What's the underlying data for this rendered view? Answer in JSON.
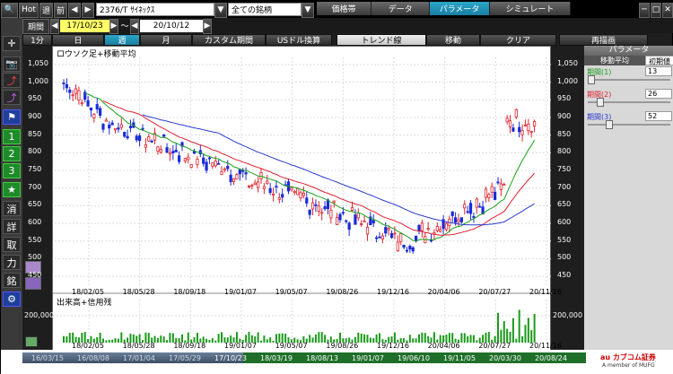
{
  "toolbar": {
    "hot": "Hot",
    "back": "退",
    "prev": "前",
    "symbol": "2376/T ｻｲﾈｯｸｽ",
    "watchlist": "全ての銘柄",
    "tabs": [
      {
        "label": "価格帯",
        "active": false
      },
      {
        "label": "データ",
        "active": false
      },
      {
        "label": "パラメータ",
        "active": true
      },
      {
        "label": "シミュレート",
        "active": false
      }
    ]
  },
  "period_bar": {
    "label": "期間",
    "start": "17/10/23",
    "tilde": "～",
    "end": "20/10/12"
  },
  "timeframes": [
    {
      "label": "1分",
      "active": false
    },
    {
      "label": "日",
      "active": false
    },
    {
      "label": "週",
      "active": true
    },
    {
      "label": "月",
      "active": false
    },
    {
      "label": "カスタム期間",
      "active": false
    },
    {
      "label": "USドル換算",
      "active": false
    }
  ],
  "tools": {
    "trend": "トレンド線",
    "move": "移動",
    "clear": "クリア",
    "redraw": "再描画"
  },
  "left_buttons": [
    "1",
    "2",
    "3",
    "★",
    "消",
    "詳",
    "取",
    "力",
    "銘"
  ],
  "chart": {
    "title": "ロウソク足+移動平均",
    "volume_title": "出来高+信用残",
    "yticks": [
      "1,050",
      "1,000",
      "950",
      "900",
      "850",
      "800",
      "750",
      "700",
      "650",
      "600",
      "550",
      "500",
      "450"
    ],
    "xticks": [
      "18/02/05",
      "18/05/28",
      "18/09/18",
      "19/01/07",
      "19/05/07",
      "19/08/26",
      "19/12/16",
      "20/04/06",
      "20/07/27",
      "20/11/16"
    ],
    "vol_tick": "200,000",
    "colors": {
      "up": "#e0242c",
      "down": "#1a2bd6",
      "ma1": "#1aa01a",
      "ma2": "#e02030",
      "ma3": "#2a3ad0"
    }
  },
  "panel": {
    "title": "パラメータ",
    "tab_ma": "移動平均",
    "tab_init": "初期値",
    "items": [
      {
        "label": "期間(1)",
        "value": "13"
      },
      {
        "label": "期間(2)",
        "value": "26"
      },
      {
        "label": "期間(3)",
        "value": "52"
      }
    ]
  },
  "navbar": {
    "ticks": [
      "16/03/15",
      "16/08/08",
      "17/01/04",
      "17/05/29",
      "17/10/23",
      "18/03/19",
      "18/08/13",
      "19/01/07",
      "19/06/10",
      "19/11/05",
      "20/03/30",
      "20/08/24"
    ]
  },
  "brand": {
    "name": "au カブコム証券",
    "sub": "A member of MUFG"
  }
}
